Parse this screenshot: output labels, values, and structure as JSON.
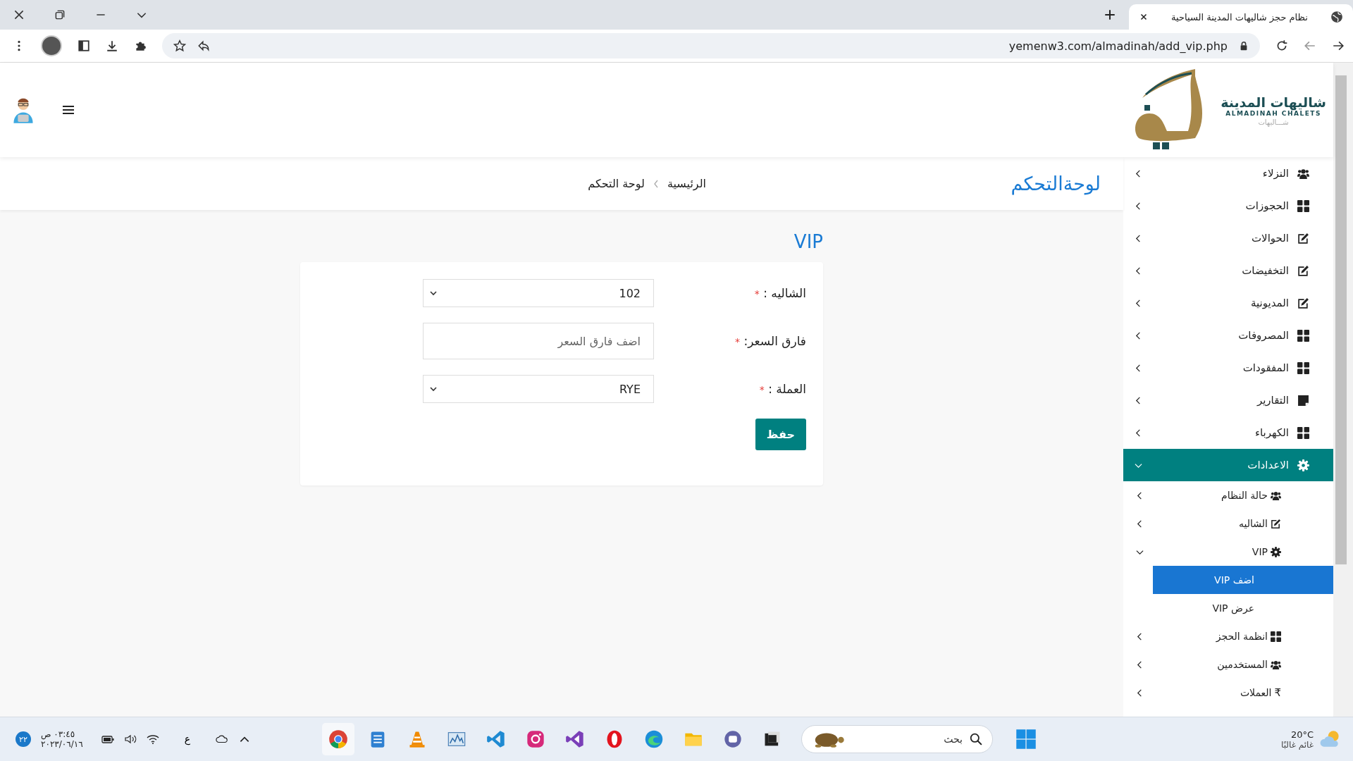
{
  "browser": {
    "tab_title": "نظام حجز شاليهات المدينة السياحية",
    "url": "yemenw3.com/almadinah/add_vip.php"
  },
  "header": {
    "logo_title": "شاليهات المدينة",
    "logo_subtitle": "ALMADINAH CHALETS",
    "logo_tagline": "شـــاليهات"
  },
  "page_title": "لوحةالتحكم",
  "breadcrumbs": [
    {
      "label": "الرئيسية"
    },
    {
      "label": "لوحة التحكم"
    }
  ],
  "section_title": "VIP",
  "form": {
    "fields": [
      {
        "kind": "select",
        "label": "الشاليه :",
        "required_mark": "*",
        "value": "102"
      },
      {
        "kind": "input",
        "label": "فارق السعر:",
        "required_mark": "*",
        "placeholder": "اضف فارق السعر"
      },
      {
        "kind": "select",
        "label": "العملة :",
        "required_mark": "*",
        "value": "RYE"
      }
    ],
    "save_button": "حفظ"
  },
  "sidebar": {
    "items": [
      {
        "label": "النزلاء",
        "expanded": false,
        "selected": false
      },
      {
        "label": "الحجوزات",
        "expanded": false,
        "selected": false
      },
      {
        "label": "الحوالات",
        "expanded": false,
        "selected": false
      },
      {
        "label": "التخفيضات",
        "expanded": false,
        "selected": false
      },
      {
        "label": "المديونية",
        "expanded": false,
        "selected": false
      },
      {
        "label": "المصروفات",
        "expanded": false,
        "selected": false
      },
      {
        "label": "المفقودات",
        "expanded": false,
        "selected": false
      },
      {
        "label": "التقارير",
        "expanded": false,
        "selected": false
      },
      {
        "label": "الكهرباء",
        "expanded": false,
        "selected": false
      },
      {
        "label": "الاعدادات",
        "expanded": true,
        "selected": false,
        "children": [
          {
            "label": "حالة النظام",
            "expanded": false,
            "selected": false
          },
          {
            "label": "الشاليه",
            "expanded": false,
            "selected": false
          },
          {
            "label": "VIP",
            "expanded": true,
            "selected": false,
            "children": [
              {
                "label": "اضف VIP",
                "selected": true
              },
              {
                "label": "عرض VIP",
                "selected": false
              }
            ]
          },
          {
            "label": "انظمة الحجز",
            "expanded": false,
            "selected": false
          },
          {
            "label": "المستخدمين",
            "expanded": false,
            "selected": false
          },
          {
            "label": "العملات",
            "glyph": "₹",
            "expanded": false,
            "selected": false
          }
        ]
      }
    ]
  },
  "taskbar": {
    "search_placeholder": "بحث",
    "temperature": "20°C",
    "weather": "غائم غالبًا",
    "keyboard_language": "ع",
    "time": "٠٣:٤٥ ص",
    "date": "٢٠٢٣/٠٦/١٦",
    "notification_count": "٢٢"
  }
}
